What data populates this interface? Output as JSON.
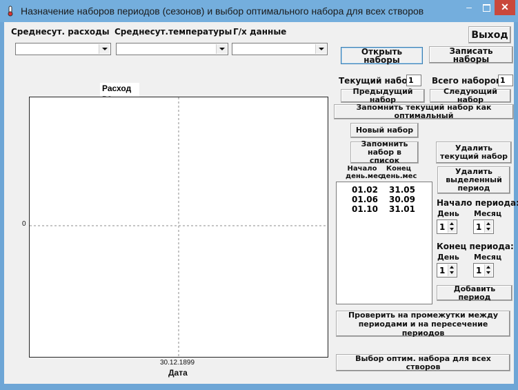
{
  "window": {
    "title": "Назначение наборов периодов (сезонов) и выбор оптимального набора для всех створов",
    "min_glyph": "–",
    "close_glyph": "✕"
  },
  "toolbar": {
    "combo_labels": [
      "Среднесут. расходы",
      "Среднесут.температуры",
      "Г/х данные"
    ],
    "exit_label": "Выход",
    "open_sets_label": "Открыть наборы",
    "save_sets_label": "Записать наборы"
  },
  "chart_data": {
    "type": "line",
    "title": "Расход во времени по створам",
    "xlabel": "Дата",
    "ylabel": "",
    "x_tick_labels": [
      "30.12.1899"
    ],
    "y_tick_labels": [
      "0"
    ],
    "series": []
  },
  "sets": {
    "current_label": "Текущий набор",
    "current_value": "1",
    "total_label": "Всего наборов",
    "total_value": "1",
    "prev_label": "Предыдущий набор",
    "next_label": "Следующий набор",
    "remember_optimal_label": "Запомнить текущий набор как оптимальный",
    "new_set_label": "Новый набор",
    "remember_to_list_label": "Запомнить набор в список",
    "delete_set_label": "Удалить текущий набор",
    "delete_period_label": "Удалить выделенный период"
  },
  "periods": {
    "col_start": "Начало день.мес",
    "col_end": "Конец день.мес",
    "rows": [
      {
        "start": "01.02",
        "end": "31.05"
      },
      {
        "start": "01.06",
        "end": "30.09"
      },
      {
        "start": "01.10",
        "end": "31.01"
      }
    ]
  },
  "period_start": {
    "heading": "Начало периода:",
    "day_label": "День",
    "month_label": "Месяц",
    "day_value": "1",
    "month_value": "1"
  },
  "period_end": {
    "heading": "Конец периода:",
    "day_label": "День",
    "month_label": "Месяц",
    "day_value": "1",
    "month_value": "1"
  },
  "actions": {
    "add_period_label": "Добавить период",
    "check_label": "Проверить на промежутки между периодами и на пересечение периодов",
    "choose_optimal_label": "Выбор  оптим. набора для всех створов"
  }
}
